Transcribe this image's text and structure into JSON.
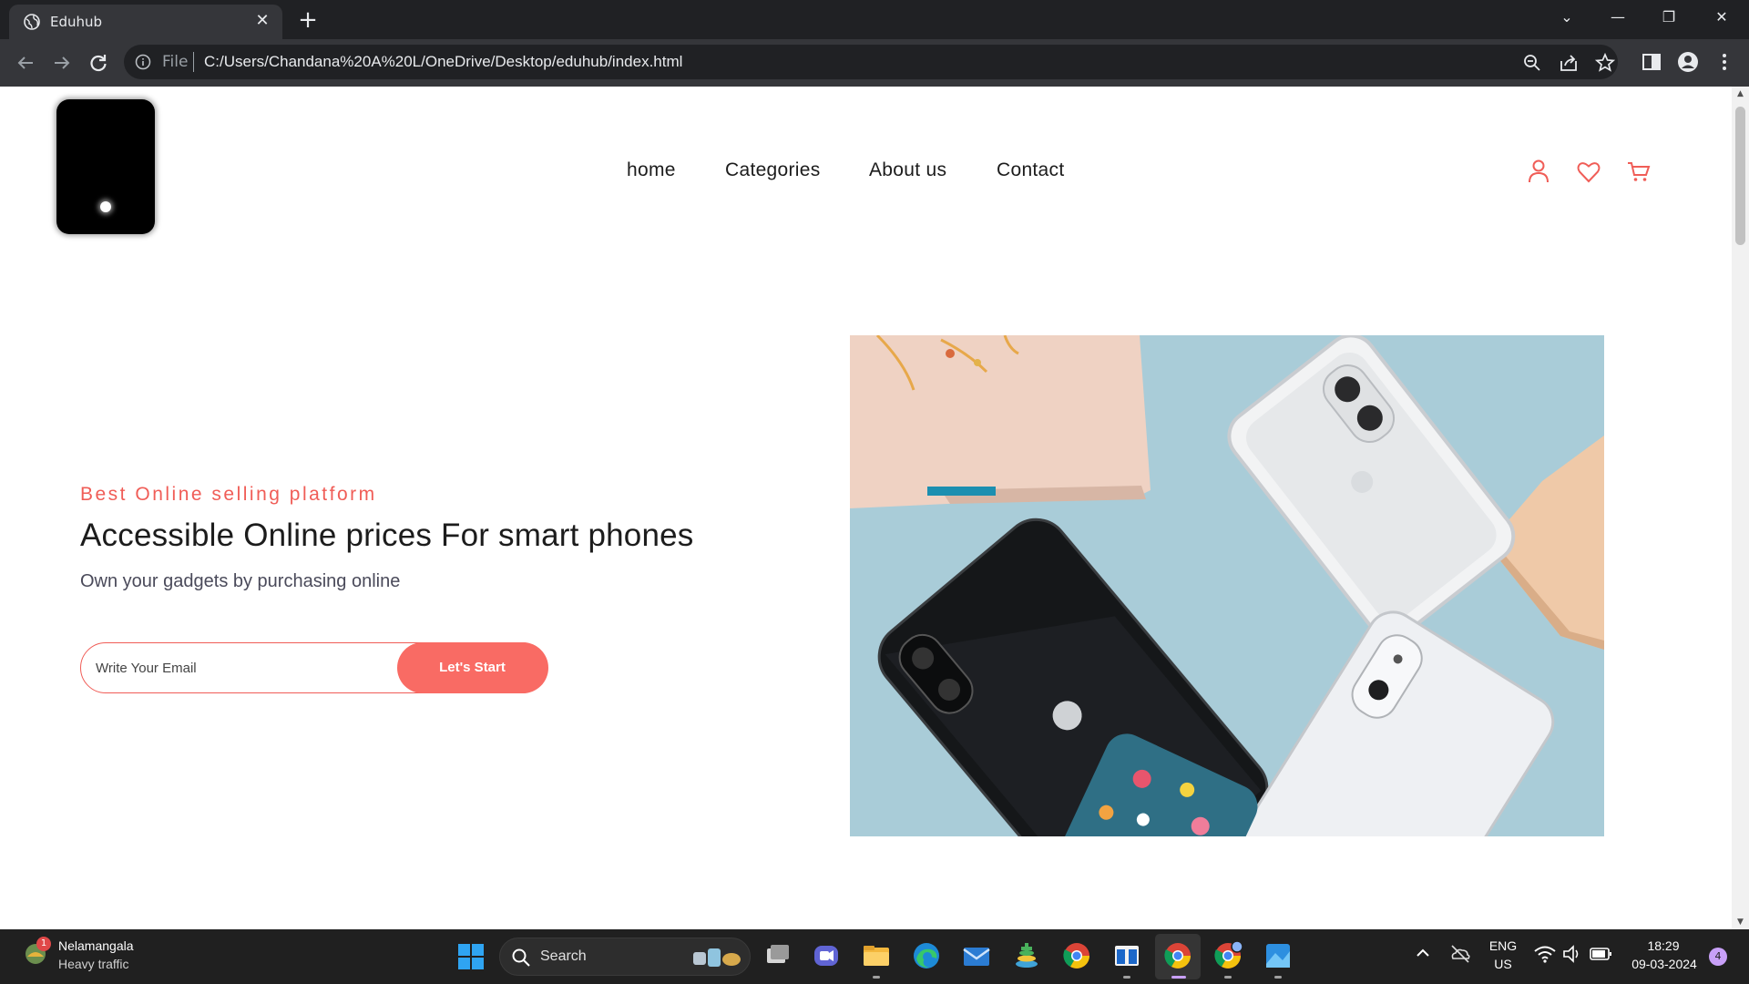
{
  "browser": {
    "tab_title": "Eduhub",
    "tab_close": "✕",
    "new_tab": "+",
    "scheme_label": "File",
    "url": "C:/Users/Chandana%20A%20L/OneDrive/Desktop/eduhub/index.html",
    "window_controls": [
      "⌄",
      "—",
      "❐",
      "✕"
    ]
  },
  "site": {
    "nav": {
      "home": "home",
      "categories": "Categories",
      "about": "About us",
      "contact": "Contact"
    },
    "hero": {
      "tagline": "Best Online selling platform",
      "title": "Accessible Online prices For smart phones",
      "description": "Own your gadgets by purchasing online",
      "email_placeholder": "Write Your Email",
      "cta_label": "Let's Start"
    },
    "accent_color": "#f96b64"
  },
  "taskbar": {
    "weather_location": "Nelamangala",
    "weather_condition": "Heavy traffic",
    "weather_badge": "1",
    "search_label": "Search",
    "language_top": "ENG",
    "language_bottom": "US",
    "time": "18:29",
    "date": "09-03-2024",
    "notification_count": "4"
  }
}
